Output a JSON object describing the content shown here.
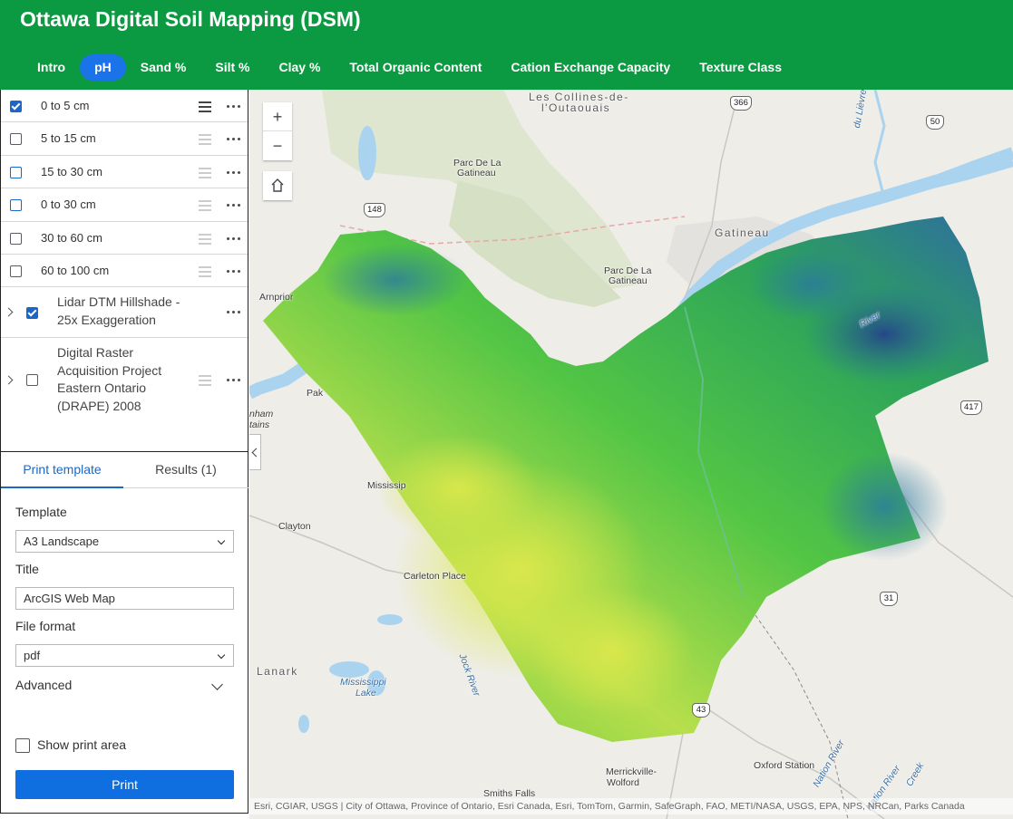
{
  "app": {
    "title": "Ottawa Digital Soil Mapping (DSM)"
  },
  "tabs": [
    {
      "label": "Intro",
      "active": false
    },
    {
      "label": "pH",
      "active": true
    },
    {
      "label": "Sand %",
      "active": false
    },
    {
      "label": "Silt %",
      "active": false
    },
    {
      "label": "Clay %",
      "active": false
    },
    {
      "label": "Total Organic Content",
      "active": false
    },
    {
      "label": "Cation Exchange Capacity",
      "active": false
    },
    {
      "label": "Texture Class",
      "active": false
    }
  ],
  "layers": {
    "depths": [
      {
        "label": "0 to 5 cm",
        "checked": true
      },
      {
        "label": "5 to 15 cm",
        "checked": false
      },
      {
        "label": "15 to 30 cm",
        "checked": false
      },
      {
        "label": "0 to 30 cm",
        "checked": false
      },
      {
        "label": "30 to 60 cm",
        "checked": false
      },
      {
        "label": "60 to 100 cm",
        "checked": false
      }
    ],
    "groups": [
      {
        "lines": [
          "Lidar DTM Hillshade -",
          "25x Exaggeration"
        ],
        "checked": true
      },
      {
        "lines": [
          "Digital Raster",
          "Acquisition Project",
          "Eastern Ontario",
          "(DRAPE) 2008"
        ],
        "checked": false
      }
    ]
  },
  "print": {
    "tabs": {
      "template": "Print template",
      "results": "Results (1)"
    },
    "template_label": "Template",
    "template_value": "A3 Landscape",
    "title_label": "Title",
    "title_value": "ArcGIS Web Map",
    "format_label": "File format",
    "format_value": "pdf",
    "advanced_label": "Advanced",
    "show_area_label": "Show print area",
    "show_area_checked": false,
    "print_button": "Print"
  },
  "map": {
    "zoom_in": "+",
    "zoom_out": "−",
    "labels": {
      "collines": "Les Collines-de-",
      "outaouais": "l'Outaouais",
      "parc1a": "Parc De La",
      "parc1b": "Gatineau",
      "gatineau": "Gatineau",
      "parc2a": "Parc De La",
      "parc2b": "Gatineau",
      "arnprior": "Arnprior",
      "pak": "Pak",
      "nham": "nham",
      "tains": "tains",
      "mississip": "Mississip",
      "clayton": "Clayton",
      "carleton": "Carleton Place",
      "lanark": "Lanark",
      "miss_lake1": "Mississippi",
      "miss_lake2": "Lake",
      "jock": "Jock River",
      "merrick1": "Merrickville-",
      "merrick2": "Wolford",
      "oxford": "Oxford Station",
      "smiths": "Smiths Falls",
      "lievre": "du Lièvre",
      "nation1": "Nation River",
      "nation2": "Nation River",
      "creek": "Creek",
      "river": "River"
    },
    "shields": {
      "r366": "366",
      "r50": "50",
      "r148": "148",
      "r417": "417",
      "r31": "31",
      "r43": "43"
    },
    "attribution": "Esri, CGIAR, USGS | City of Ottawa, Province of Ontario, Esri Canada, Esri, TomTom, Garmin, SafeGraph, FAO, METI/NASA, USGS, EPA, NPS, NRCan, Parks Canada"
  },
  "colors": {
    "header": "#0b9a41",
    "accent": "#1a73e8",
    "ph_low": "#27408b",
    "ph_mid": "#2fb850",
    "ph_high": "#d9e84a"
  }
}
